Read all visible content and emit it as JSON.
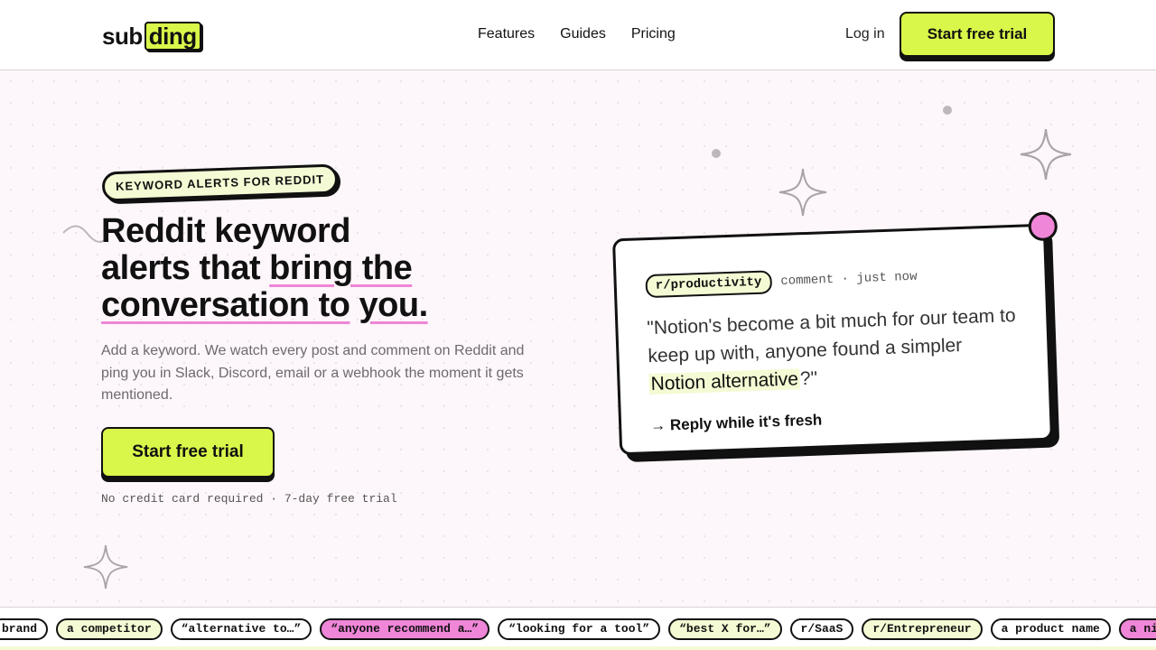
{
  "header": {
    "logo_part1": "sub",
    "logo_part2": "ding",
    "nav": [
      {
        "label": "Features"
      },
      {
        "label": "Guides"
      },
      {
        "label": "Pricing"
      }
    ],
    "login_label": "Log in",
    "cta_label": "Start free trial"
  },
  "hero": {
    "eyebrow": "KEYWORD ALERTS FOR REDDIT",
    "title_line1": "Reddit keyword",
    "title_line2_a": "alerts that ",
    "title_line2_b": "bring the",
    "title_line3_a": "conversation to",
    "title_line3_b": "you.",
    "subtitle": "Add a keyword. We watch every post and comment on Reddit and ping you in Slack, Discord, email or a webhook the moment it gets mentioned.",
    "cta_label": "Start free trial",
    "note": "No credit card required · 7-day free trial"
  },
  "card": {
    "subreddit": "r/productivity",
    "meta": "comment · just now",
    "quote_a": "\"Notion's become a bit much for our team to keep up with, anyone found a simpler ",
    "quote_keyword": "Notion alternative",
    "quote_b": "?\"",
    "reply_label": "→ Reply while it's fresh"
  },
  "marquee": [
    {
      "label": "brand",
      "style": "white"
    },
    {
      "label": "a competitor",
      "style": "lime"
    },
    {
      "label": "“alternative to…”",
      "style": "white"
    },
    {
      "label": "“anyone recommend a…”",
      "style": "pink"
    },
    {
      "label": "“looking for a tool”",
      "style": "white"
    },
    {
      "label": "“best X for…”",
      "style": "lime"
    },
    {
      "label": "r/SaaS",
      "style": "white"
    },
    {
      "label": "r/Entrepreneur",
      "style": "lime"
    },
    {
      "label": "a product name",
      "style": "white"
    },
    {
      "label": "a niche t",
      "style": "pink"
    }
  ],
  "colors": {
    "accent_lime": "#d9f74a",
    "accent_pink": "#ef86d8",
    "background": "#fdf6fa"
  }
}
